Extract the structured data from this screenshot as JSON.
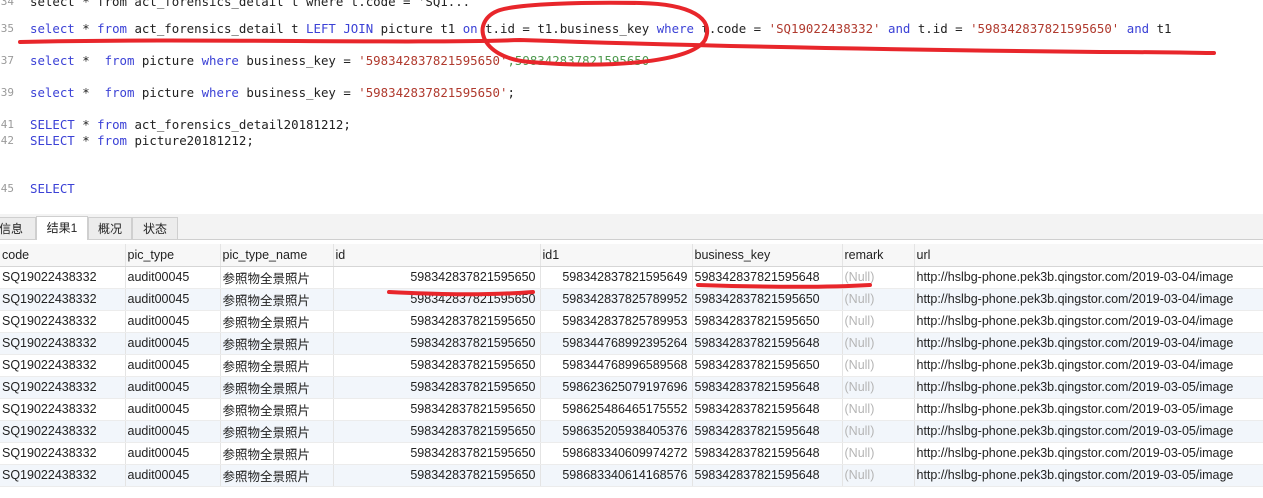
{
  "editor": {
    "lines": [
      {
        "num": "34",
        "segments": [
          {
            "t": "select * from act_forensics_detail t where t.code = 'SQ1...",
            "c": ""
          }
        ]
      },
      {
        "num": "35",
        "segments": [
          {
            "t": "select",
            "c": "kw"
          },
          {
            "t": " * ",
            "c": ""
          },
          {
            "t": "from",
            "c": "kw"
          },
          {
            "t": " act_forensics_detail t ",
            "c": ""
          },
          {
            "t": "LEFT JOIN",
            "c": "kw"
          },
          {
            "t": " picture t1 ",
            "c": ""
          },
          {
            "t": "on",
            "c": "kw"
          },
          {
            "t": " t.id = t1.business_key ",
            "c": ""
          },
          {
            "t": "where",
            "c": "kw"
          },
          {
            "t": " t.code = ",
            "c": ""
          },
          {
            "t": "'SQ19022438332'",
            "c": "str"
          },
          {
            "t": " ",
            "c": ""
          },
          {
            "t": "and",
            "c": "kw"
          },
          {
            "t": " t.id = ",
            "c": ""
          },
          {
            "t": "'598342837821595650'",
            "c": "str"
          },
          {
            "t": " ",
            "c": ""
          },
          {
            "t": "and",
            "c": "kw"
          },
          {
            "t": " t1",
            "c": ""
          }
        ]
      },
      {
        "num": "37",
        "segments": [
          {
            "t": "select",
            "c": "kw"
          },
          {
            "t": " *  ",
            "c": ""
          },
          {
            "t": "from",
            "c": "kw"
          },
          {
            "t": " picture ",
            "c": ""
          },
          {
            "t": "where",
            "c": "kw"
          },
          {
            "t": " business_key = ",
            "c": ""
          },
          {
            "t": "'598342837821595650'",
            "c": "str"
          },
          {
            "t": ";598342837821595650",
            "c": "cmt"
          }
        ]
      },
      {
        "num": "39",
        "segments": [
          {
            "t": "select",
            "c": "kw"
          },
          {
            "t": " *  ",
            "c": ""
          },
          {
            "t": "from",
            "c": "kw"
          },
          {
            "t": " picture ",
            "c": ""
          },
          {
            "t": "where",
            "c": "kw"
          },
          {
            "t": " business_key = ",
            "c": ""
          },
          {
            "t": "'598342837821595650'",
            "c": "str"
          },
          {
            "t": ";",
            "c": ""
          }
        ]
      },
      {
        "num": "41",
        "segments": [
          {
            "t": "SELECT",
            "c": "kw"
          },
          {
            "t": " * ",
            "c": ""
          },
          {
            "t": "from",
            "c": "kw"
          },
          {
            "t": " act_forensics_detail20181212;",
            "c": ""
          }
        ]
      },
      {
        "num": "42",
        "segments": [
          {
            "t": "SELECT",
            "c": "kw"
          },
          {
            "t": " * ",
            "c": ""
          },
          {
            "t": "from",
            "c": "kw"
          },
          {
            "t": " picture20181212;",
            "c": ""
          }
        ]
      },
      {
        "num": "45",
        "segments": [
          {
            "t": "SELECT",
            "c": "kw"
          }
        ]
      }
    ]
  },
  "tabs": [
    {
      "label": "信息",
      "active": false
    },
    {
      "label": "结果1",
      "active": true
    },
    {
      "label": "概况",
      "active": false
    },
    {
      "label": "状态",
      "active": false
    }
  ],
  "grid": {
    "columns": [
      "code",
      "pic_type",
      "pic_type_name",
      "id",
      "id1",
      "business_key",
      "remark",
      "url"
    ],
    "rows": [
      [
        "SQ19022438332",
        "audit00045",
        "参照物全景照片",
        "598342837821595650",
        "598342837821595649",
        "598342837821595648",
        "(Null)",
        "http://hslbg-phone.pek3b.qingstor.com/2019-03-04/image"
      ],
      [
        "SQ19022438332",
        "audit00045",
        "参照物全景照片",
        "598342837821595650",
        "598342837825789952",
        "598342837821595650",
        "(Null)",
        "http://hslbg-phone.pek3b.qingstor.com/2019-03-04/image"
      ],
      [
        "SQ19022438332",
        "audit00045",
        "参照物全景照片",
        "598342837821595650",
        "598342837825789953",
        "598342837821595650",
        "(Null)",
        "http://hslbg-phone.pek3b.qingstor.com/2019-03-04/image"
      ],
      [
        "SQ19022438332",
        "audit00045",
        "参照物全景照片",
        "598342837821595650",
        "598344768992395264",
        "598342837821595648",
        "(Null)",
        "http://hslbg-phone.pek3b.qingstor.com/2019-03-04/image"
      ],
      [
        "SQ19022438332",
        "audit00045",
        "参照物全景照片",
        "598342837821595650",
        "598344768996589568",
        "598342837821595650",
        "(Null)",
        "http://hslbg-phone.pek3b.qingstor.com/2019-03-04/image"
      ],
      [
        "SQ19022438332",
        "audit00045",
        "参照物全景照片",
        "598342837821595650",
        "598623625079197696",
        "598342837821595648",
        "(Null)",
        "http://hslbg-phone.pek3b.qingstor.com/2019-03-05/image"
      ],
      [
        "SQ19022438332",
        "audit00045",
        "参照物全景照片",
        "598342837821595650",
        "598625486465175552",
        "598342837821595648",
        "(Null)",
        "http://hslbg-phone.pek3b.qingstor.com/2019-03-05/image"
      ],
      [
        "SQ19022438332",
        "audit00045",
        "参照物全景照片",
        "598342837821595650",
        "598635205938405376",
        "598342837821595648",
        "(Null)",
        "http://hslbg-phone.pek3b.qingstor.com/2019-03-05/image"
      ],
      [
        "SQ19022438332",
        "audit00045",
        "参照物全景照片",
        "598342837821595650",
        "598683340609974272",
        "598342837821595648",
        "(Null)",
        "http://hslbg-phone.pek3b.qingstor.com/2019-03-05/image"
      ],
      [
        "SQ19022438332",
        "audit00045",
        "参照物全景照片",
        "598342837821595650",
        "598683340614168576",
        "598342837821595648",
        "(Null)",
        "http://hslbg-phone.pek3b.qingstor.com/2019-03-05/image"
      ]
    ]
  },
  "colors": {
    "keyword": "#3b41d6",
    "string": "#b03a2e",
    "comment": "#4f9a4f",
    "annotation": "#e8262b"
  }
}
